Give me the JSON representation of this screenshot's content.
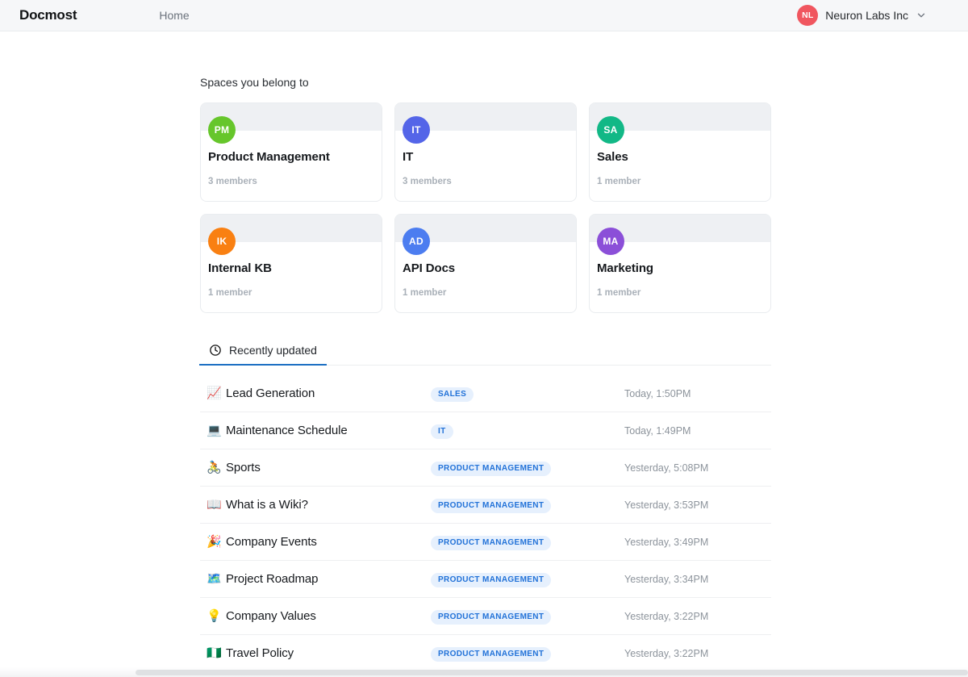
{
  "topbar": {
    "brand": "Docmost",
    "home_label": "Home",
    "org_initials": "NL",
    "org_name": "Neuron Labs Inc",
    "org_avatar_color": "#f0565f",
    "chevron_icon": "chevron-down-icon"
  },
  "spaces": {
    "section_title": "Spaces you belong to",
    "items": [
      {
        "initials": "PM",
        "name": "Product Management",
        "members": "3 members",
        "color": "#66c62b"
      },
      {
        "initials": "IT",
        "name": "IT",
        "members": "3 members",
        "color": "#5465e8"
      },
      {
        "initials": "SA",
        "name": "Sales",
        "members": "1 member",
        "color": "#12b886"
      },
      {
        "initials": "IK",
        "name": "Internal KB",
        "members": "1 member",
        "color": "#f98012"
      },
      {
        "initials": "AD",
        "name": "API Docs",
        "members": "1 member",
        "color": "#4c7df0"
      },
      {
        "initials": "MA",
        "name": "Marketing",
        "members": "1 member",
        "color": "#8b4fd8"
      }
    ]
  },
  "tabs": [
    {
      "label": "Recently updated",
      "icon": "clock-icon",
      "active": true
    }
  ],
  "recent": {
    "accent_color": "#1b6ec2",
    "badge_bg": "#e6f0fd",
    "badge_fg": "#2272d8",
    "rows": [
      {
        "emoji": "📈",
        "emoji_name": "chart-increasing-icon",
        "title": "Lead Generation",
        "space": "Sales",
        "date": "Today, 1:50PM"
      },
      {
        "emoji": "💻",
        "emoji_name": "laptop-icon",
        "title": "Maintenance Schedule",
        "space": "IT",
        "date": "Today, 1:49PM"
      },
      {
        "emoji": "🚴",
        "emoji_name": "cyclist-icon",
        "title": "Sports",
        "space": "Product Management",
        "date": "Yesterday, 5:08PM"
      },
      {
        "emoji": "📖",
        "emoji_name": "open-book-icon",
        "title": "What is a Wiki?",
        "space": "Product Management",
        "date": "Yesterday, 3:53PM"
      },
      {
        "emoji": "🎉",
        "emoji_name": "party-popper-icon",
        "title": "Company Events",
        "space": "Product Management",
        "date": "Yesterday, 3:49PM"
      },
      {
        "emoji": "🗺️",
        "emoji_name": "world-map-icon",
        "title": "Project Roadmap",
        "space": "Product Management",
        "date": "Yesterday, 3:34PM"
      },
      {
        "emoji": "💡",
        "emoji_name": "light-bulb-icon",
        "title": "Company Values",
        "space": "Product Management",
        "date": "Yesterday, 3:22PM"
      },
      {
        "emoji": "🇳🇬",
        "emoji_name": "flag-icon",
        "title": "Travel Policy",
        "space": "Product Management",
        "date": "Yesterday, 3:22PM"
      }
    ]
  }
}
